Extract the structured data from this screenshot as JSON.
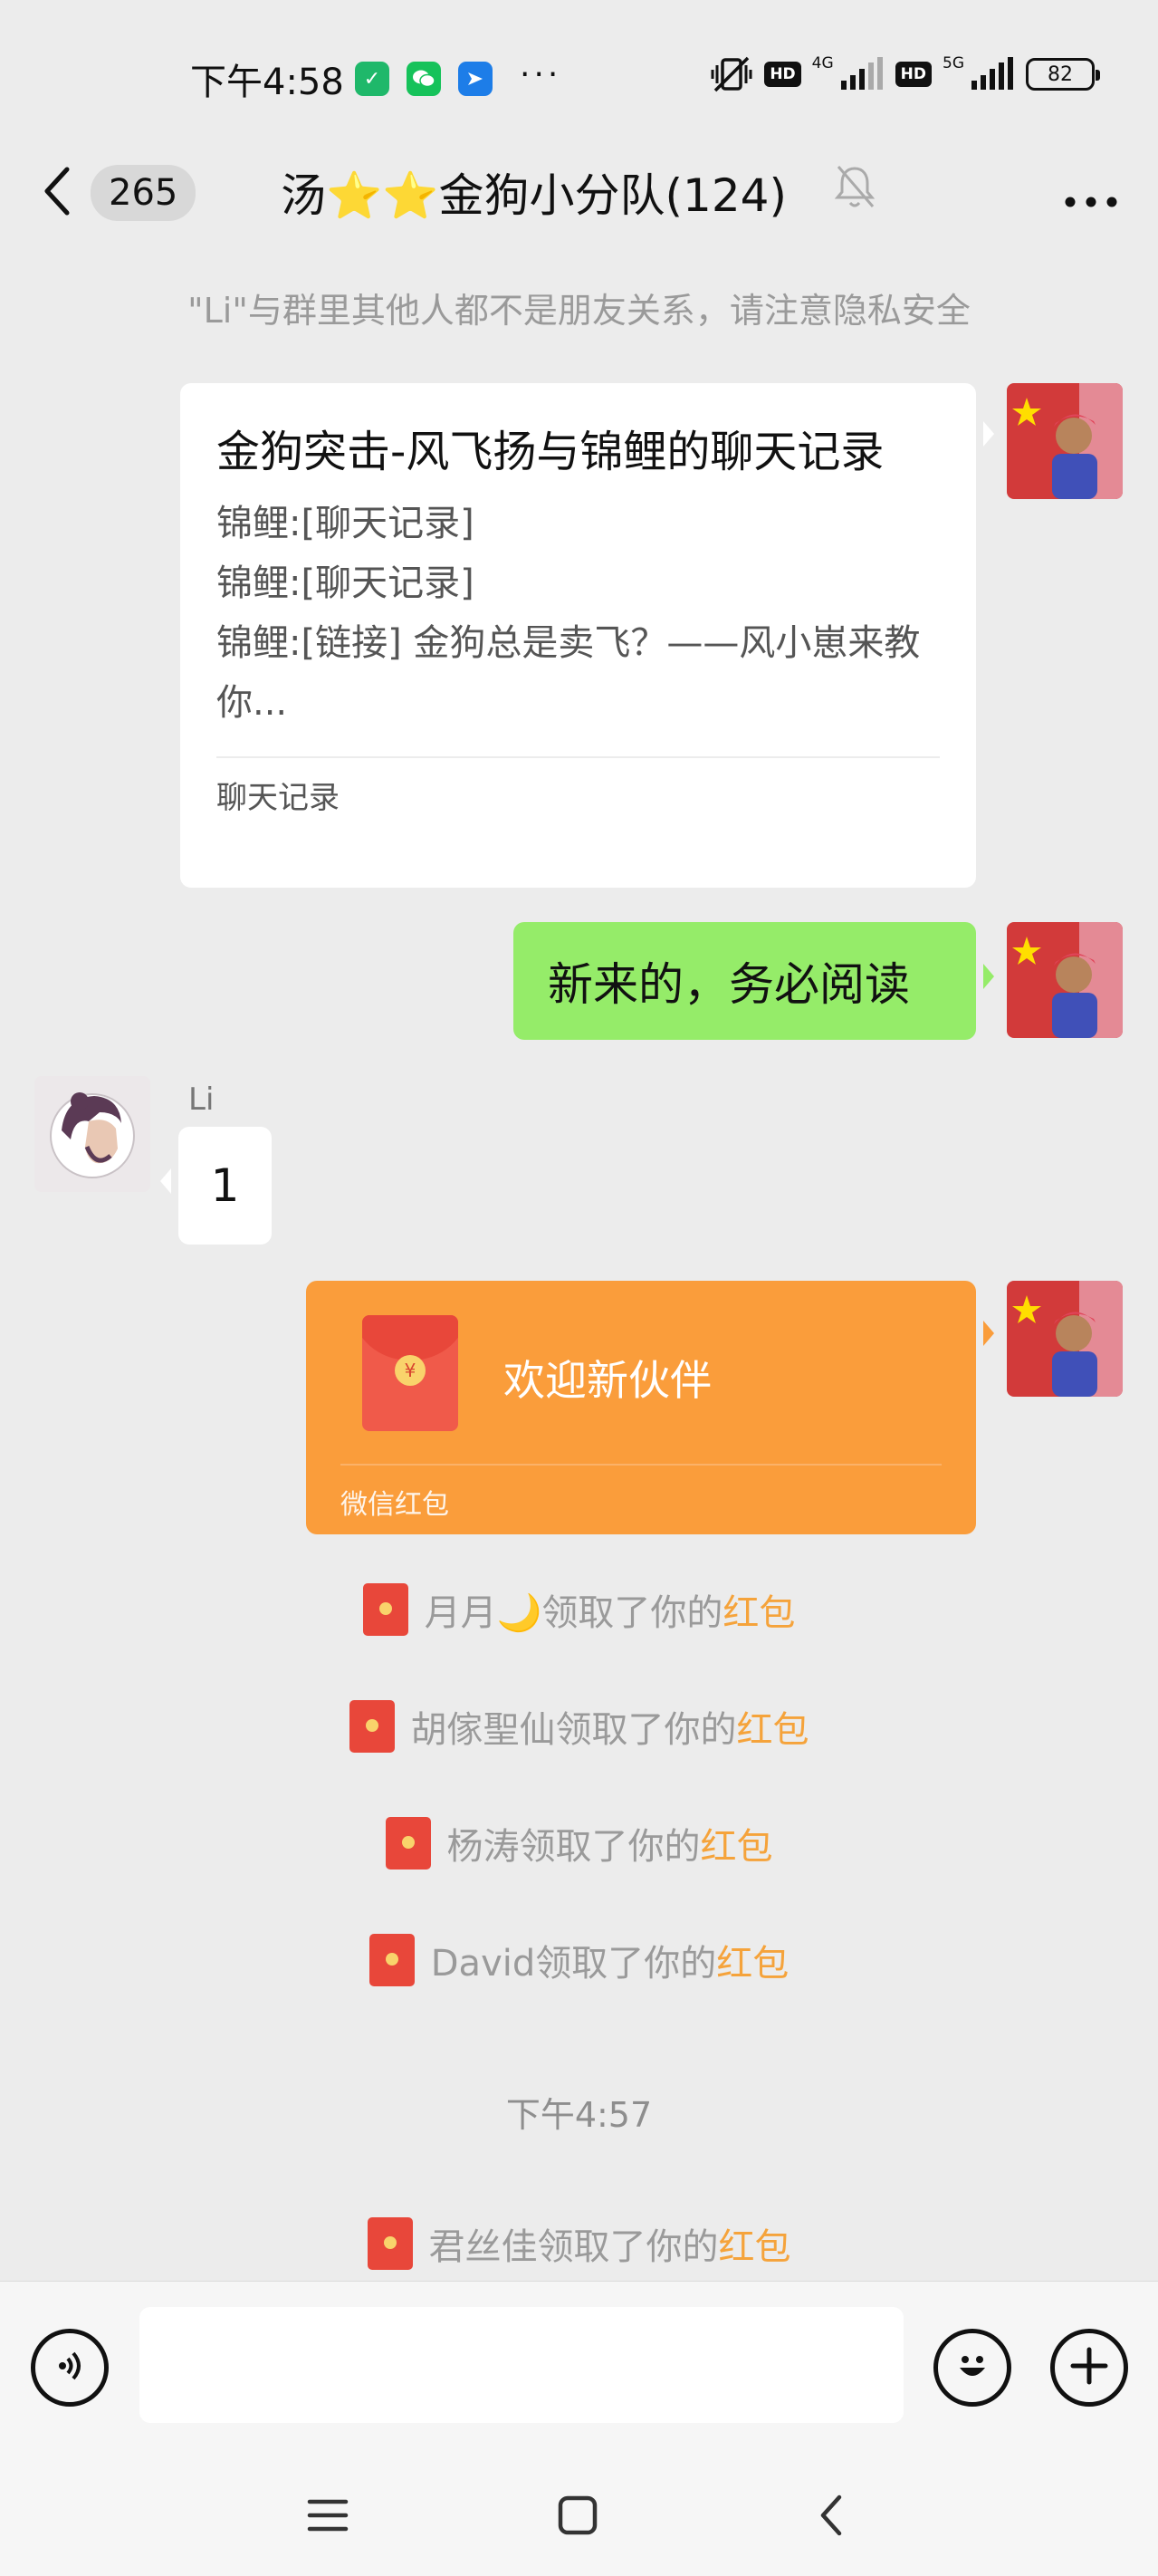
{
  "status_bar": {
    "time": "下午4:58",
    "network_4g": "4G",
    "network_5g": "5G",
    "hd": "HD",
    "battery": "82"
  },
  "header": {
    "unread_count": "265",
    "title": "汤⭐⭐金狗小分队(124)"
  },
  "notice": "\"Li\"与群里其他人都不是朋友关系，请注意隐私安全",
  "card_message": {
    "title": "金狗突击-风飞扬与锦鲤的聊天记录",
    "lines": [
      "锦鲤:[聊天记录]",
      "锦鲤:[聊天记录]",
      "锦鲤:[链接] 金狗总是卖飞？——风小崽来教你..."
    ],
    "footer": "聊天记录"
  },
  "green_message": "新来的，务必阅读",
  "li_message": {
    "sender": "Li",
    "text": "1"
  },
  "red_packet": {
    "title": "欢迎新伙伴",
    "label": "微信红包"
  },
  "claims": [
    {
      "prefix": "月月🌙领取了你的",
      "link": "红包"
    },
    {
      "prefix": "胡傢聖仙领取了你的",
      "link": "红包"
    },
    {
      "prefix": "杨涛领取了你的",
      "link": "红包"
    },
    {
      "prefix": "David领取了你的",
      "link": "红包"
    },
    {
      "prefix": "君丝佳领取了你的",
      "link": "红包"
    }
  ],
  "timestamp": "下午4:57",
  "input": {
    "value": ""
  },
  "colors": {
    "background": "#ececec",
    "green_bubble": "#95ec69",
    "red_packet": "#fa9d3b",
    "red_packet_link": "#f5a33b"
  }
}
